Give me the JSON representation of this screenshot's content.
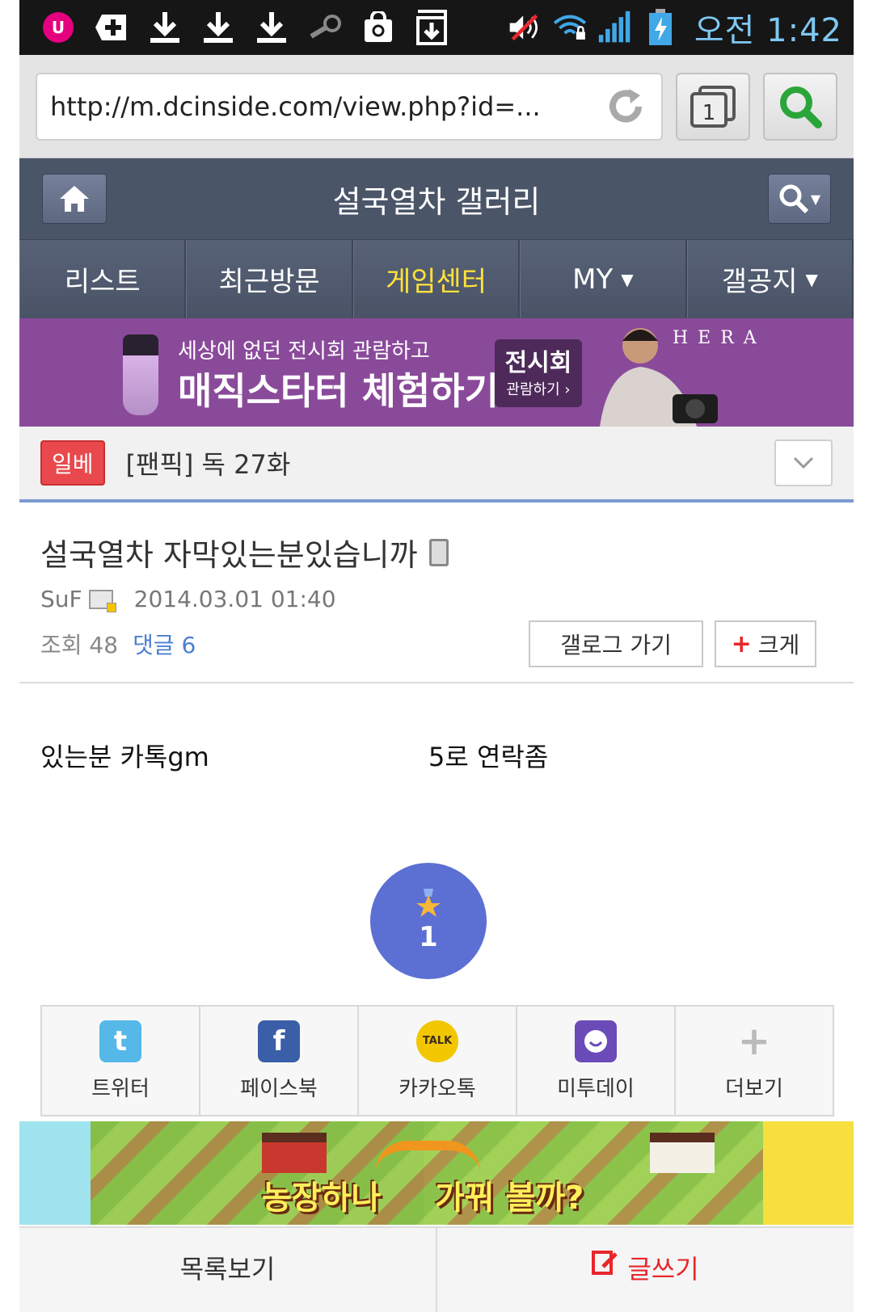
{
  "status_bar": {
    "time": "오전 1:42",
    "left_icons": [
      "uplus-icon",
      "plus-shield-icon",
      "download-icon",
      "download-icon",
      "download-icon",
      "steam-icon",
      "shopping-bag-icon",
      "download-box-icon"
    ],
    "right_icons": [
      "mute-icon",
      "wifi-lock-icon",
      "signal-icon",
      "battery-charging-icon"
    ]
  },
  "browser": {
    "url": "http://m.dcinside.com/view.php?id=...",
    "tab_count": "1"
  },
  "gallery": {
    "title": "설국열차 갤러리"
  },
  "nav": {
    "tabs": [
      {
        "label": "리스트",
        "active": false
      },
      {
        "label": "최근방문",
        "active": false
      },
      {
        "label": "게임센터",
        "active": true
      },
      {
        "label": "MY",
        "active": false
      },
      {
        "label": "갤공지",
        "active": false
      }
    ]
  },
  "banner": {
    "small_text": "세상에 없던 전시회 관람하고",
    "big_text": "매직스타터 체험하기!",
    "cta_main": "전시회",
    "cta_sub": "관람하기 ›",
    "brand": "HERA"
  },
  "hot_post": {
    "badge": "일베",
    "title": "[팬픽] 독 27화"
  },
  "post": {
    "title": "설국열차 자막있는분있습니까",
    "author": "SuF",
    "date": "2014.03.01 01:40",
    "views_label": "조회 48",
    "comments_label": "댓글 6",
    "gallog_button": "갤로그 가기",
    "bigger_button": "크게",
    "body_left": "있는분 카톡gm",
    "body_right": "5로 연락좀",
    "recommend_count": "1"
  },
  "share": {
    "items": [
      {
        "label": "트위터",
        "icon": "twitter-icon",
        "color": "#56b8e8"
      },
      {
        "label": "페이스북",
        "icon": "facebook-icon",
        "color": "#3b5ea8"
      },
      {
        "label": "카카오톡",
        "icon": "kakaotalk-icon",
        "color": "#f2c700"
      },
      {
        "label": "미투데이",
        "icon": "metoday-icon",
        "color": "#6a4bb8"
      },
      {
        "label": "더보기",
        "icon": "plus-icon",
        "color": "#bbbbbb"
      }
    ]
  },
  "game_ad": {
    "text_left": "농장하나",
    "text_right": "가꿔 볼까?"
  },
  "bottom": {
    "list_label": "목록보기",
    "write_label": "글쓰기"
  },
  "colors": {
    "header_bg": "#4b5568",
    "active_tab": "#ffe23a",
    "banner_bg": "#8a4a9a",
    "badge_red": "#e9494c",
    "recommend_blue": "#5c6fd3",
    "link_blue": "#4a7fd0"
  }
}
